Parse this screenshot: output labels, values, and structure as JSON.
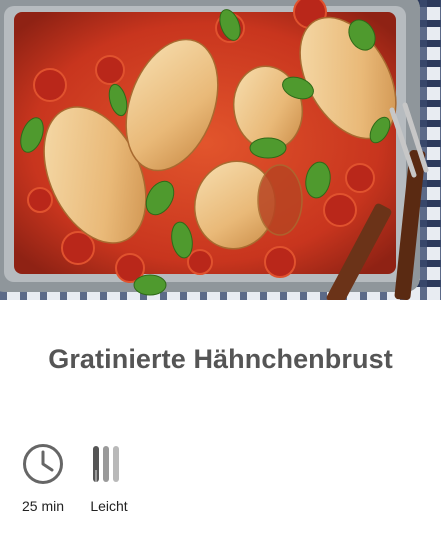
{
  "recipe": {
    "title": "Gratinierte Hähnchenbrust",
    "meta": {
      "time": {
        "icon": "clock-icon",
        "label": "25 min"
      },
      "difficulty": {
        "icon": "cutlery-icon",
        "label": "Leicht"
      }
    }
  },
  "colors": {
    "title": "#555555",
    "sauce": "#c8351e",
    "icon": "#666666"
  }
}
